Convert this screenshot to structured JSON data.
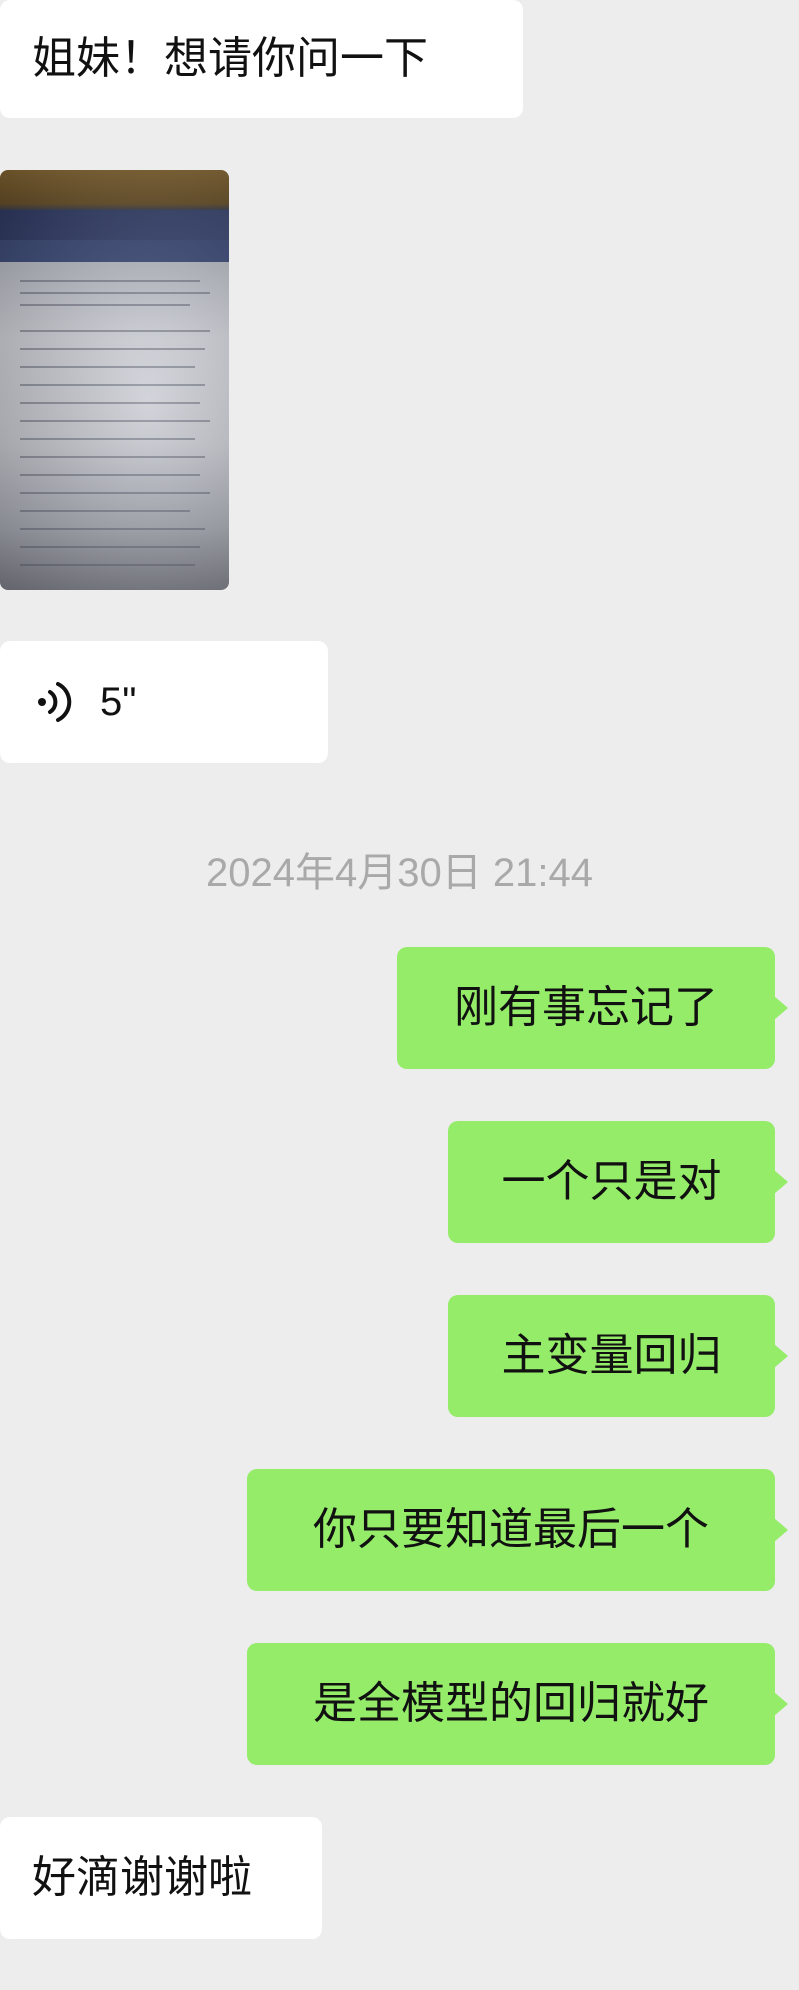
{
  "messages": {
    "m1": "姐妹！想请你问一下",
    "voice_duration": "5\"",
    "timestamp": "2024年4月30日 21:44",
    "m2": "刚有事忘记了",
    "m3": "一个只是对",
    "m4": "主变量回归",
    "m5": "你只要知道最后一个",
    "m6": "是全模型的回归就好",
    "m7": "好滴谢谢啦"
  },
  "icons": {
    "voice": "voice-wave-icon",
    "photo": "image-thumbnail"
  },
  "colors": {
    "background": "#ededed",
    "incoming_bubble": "#ffffff",
    "outgoing_bubble": "#95ec69",
    "timestamp": "#a9a9a9"
  }
}
